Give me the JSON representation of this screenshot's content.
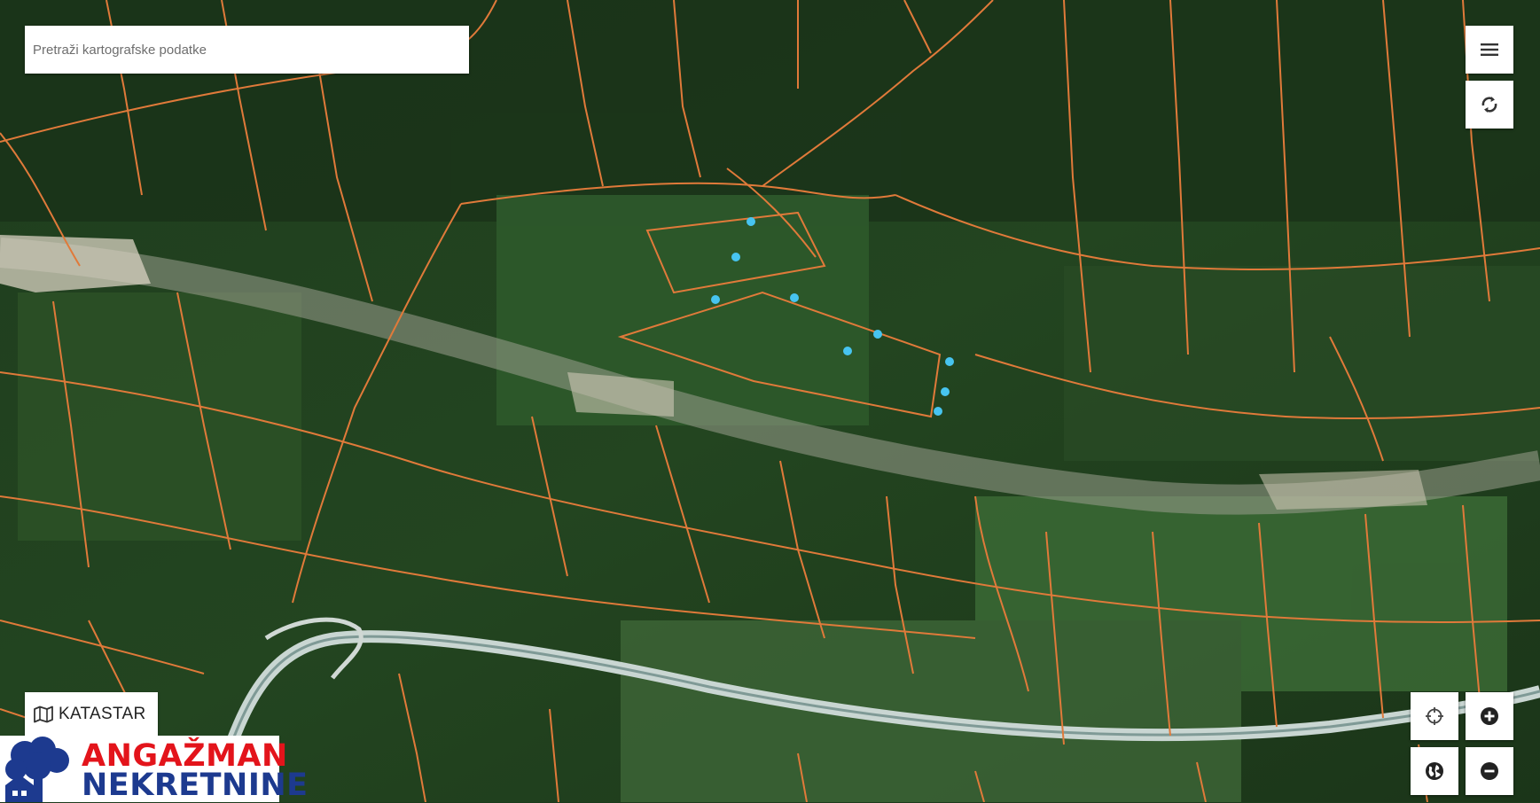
{
  "search": {
    "placeholder": "Pretraži kartografske podatke"
  },
  "controls": {
    "menu": "menu-icon",
    "refresh": "refresh-icon",
    "locate": "crosshair-icon",
    "zoom_in": "plus-circle-icon",
    "basemap": "globe-icon",
    "zoom_out": "minus-circle-icon"
  },
  "layer_toggle": {
    "label": "KATASTAR",
    "icon": "map-icon"
  },
  "logo": {
    "line1": "ANGAŽMAN",
    "line2": "NEKRETNINE"
  },
  "colors": {
    "parcel_border": "#e07a3a",
    "marker": "#47c4f0",
    "logo_red": "#e3141b",
    "logo_blue": "#1d3a8f"
  }
}
